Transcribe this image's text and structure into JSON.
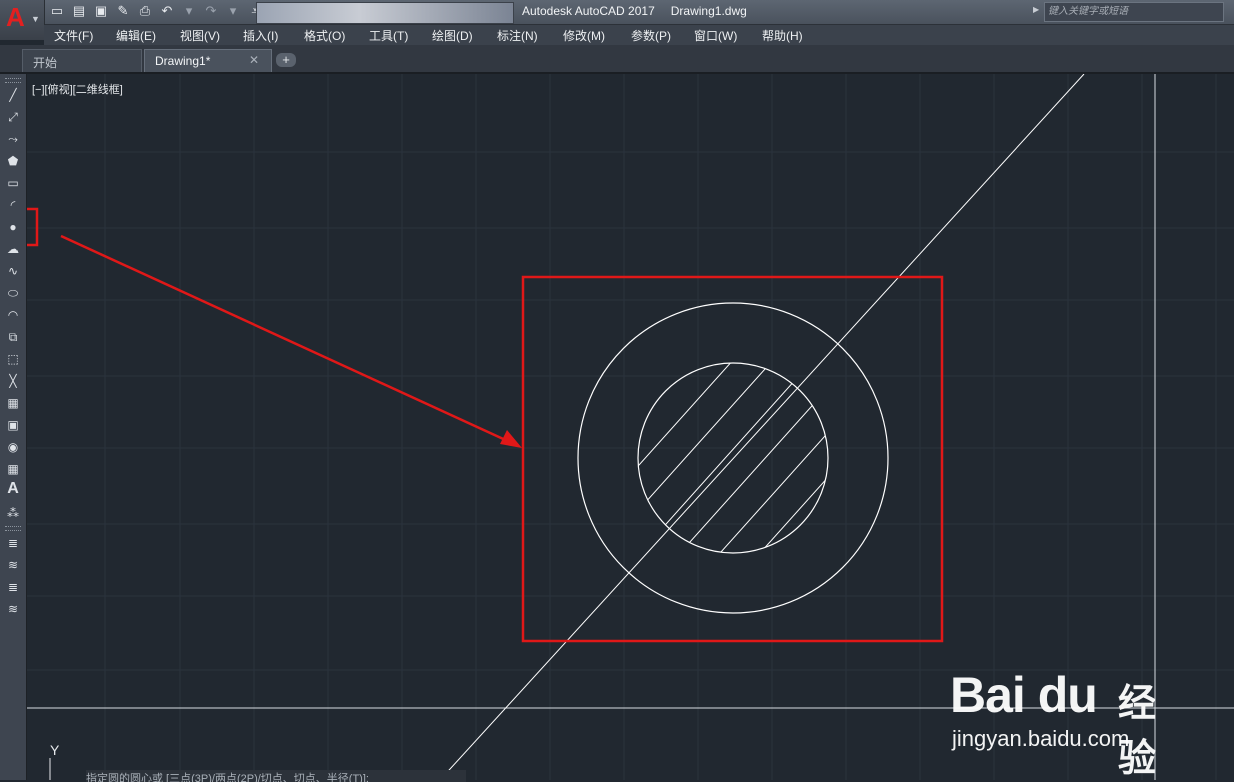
{
  "window": {
    "app_name": "Autodesk AutoCAD 2017",
    "file_name": "Drawing1.dwg",
    "app_logo": "A",
    "search_placeholder": "键入关键字或短语"
  },
  "quick_access": [
    "new-icon",
    "open-icon",
    "save-icon",
    "saveas-icon",
    "print-icon",
    "undo-icon",
    "dropdown-icon",
    "redo-icon",
    "dropdown-icon",
    "customize-icon"
  ],
  "menu": [
    "文件(F)",
    "编辑(E)",
    "视图(V)",
    "插入(I)",
    "格式(O)",
    "工具(T)",
    "绘图(D)",
    "标注(N)",
    "修改(M)",
    "参数(P)",
    "窗口(W)",
    "帮助(H)"
  ],
  "tabs": {
    "start": "开始",
    "drawing": "Drawing1*",
    "close": "✕",
    "add": "+"
  },
  "toolbar_tools": [
    "line-icon",
    "construction-line-icon",
    "polyline-icon",
    "polygon-icon",
    "rectangle-icon",
    "arc-icon",
    "circle-icon",
    "revision-cloud-icon",
    "spline-icon",
    "ellipse-icon",
    "ellipse-arc-icon",
    "insert-block-icon",
    "make-block-icon",
    "point-icon",
    "hatch-icon",
    "gradient-icon",
    "region-icon",
    "table-icon",
    "multiline-text-icon",
    "add-selected-icon",
    "layer-icon-1",
    "layer-icon-2",
    "layer-icon-3",
    "layer-icon-4"
  ],
  "viewport_label": "[−][俯视][二维线框]",
  "command_line": "指定圆的圆心或 [三点(3P)/两点(2P)/切点、切点、半径(T)]:",
  "ucs_label": "Y",
  "watermark": {
    "brand": "Bai du",
    "cn": "经验",
    "url": "jingyan.baidu.com"
  },
  "colors": {
    "canvas": "#212830",
    "grid": "#2b333d",
    "geometry": "#ffffff",
    "annotation": "#e01818"
  }
}
